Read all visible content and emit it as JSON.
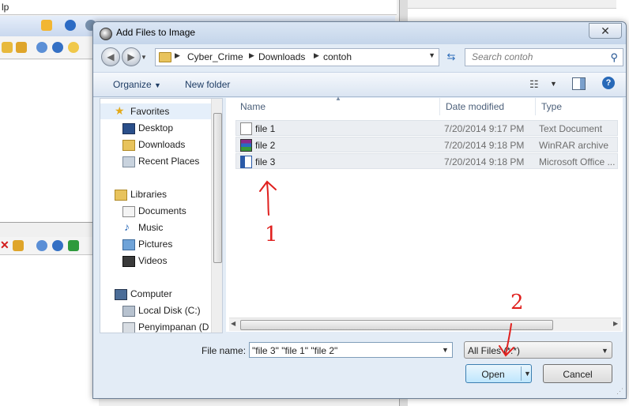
{
  "background_app": {
    "menu_fragment": "lp"
  },
  "dialog": {
    "title": "Add Files to Image",
    "close_glyph": "✕",
    "breadcrumb": [
      "Cyber_Crime",
      "Downloads",
      "contoh"
    ],
    "search_placeholder": "Search contoh",
    "toolbar": {
      "organize": "Organize",
      "new_folder": "New folder"
    },
    "nav_pane": {
      "favorites_header": "Favorites",
      "favorites": [
        "Desktop",
        "Downloads",
        "Recent Places"
      ],
      "libraries_header": "Libraries",
      "libraries": [
        "Documents",
        "Music",
        "Pictures",
        "Videos"
      ],
      "computer_header": "Computer",
      "computer": [
        "Local Disk (C:)",
        "Penyimpanan (D"
      ]
    },
    "columns": {
      "name": "Name",
      "date_modified": "Date modified",
      "type": "Type"
    },
    "files": [
      {
        "name": "file 1",
        "date": "7/20/2014 9:17 PM",
        "type": "Text Document",
        "icon": "text-document-icon"
      },
      {
        "name": "file 2",
        "date": "7/20/2014 9:18 PM",
        "type": "WinRAR archive",
        "icon": "winrar-archive-icon"
      },
      {
        "name": "file 3",
        "date": "7/20/2014 9:18 PM",
        "type": "Microsoft Office ...",
        "icon": "word-document-icon"
      }
    ],
    "file_name_label": "File name:",
    "file_name_value": "\"file 3\" \"file 1\" \"file 2\"",
    "file_type_value": "All Files (*.*)",
    "open_label": "Open",
    "cancel_label": "Cancel"
  },
  "annotations": {
    "step1": "1",
    "step2": "2",
    "color": "#e0201e"
  }
}
